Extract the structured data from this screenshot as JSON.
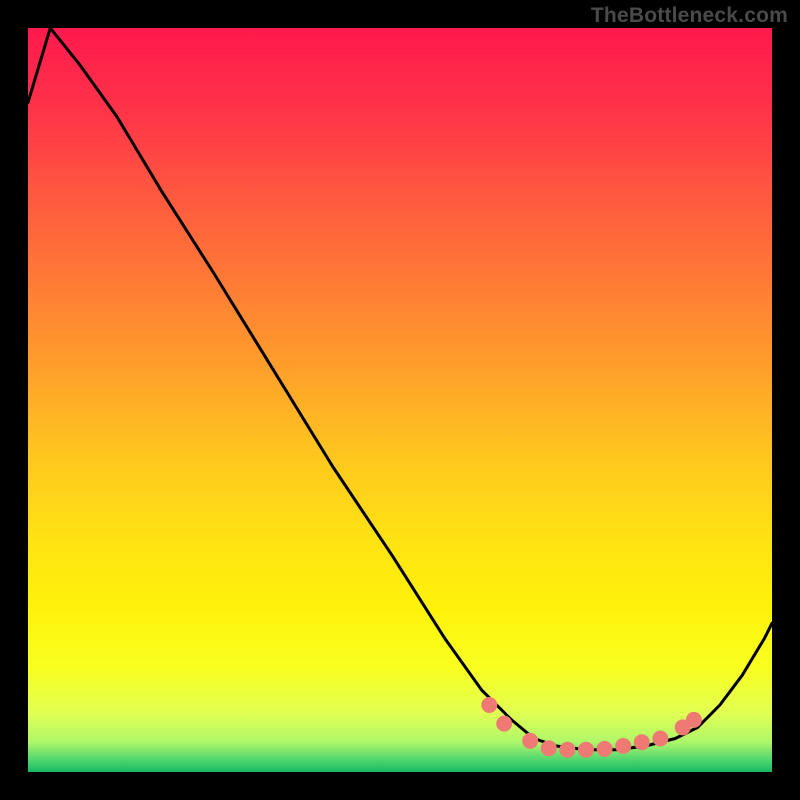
{
  "watermark": "TheBottleneck.com",
  "gradient": {
    "stops": [
      {
        "offset": 0.0,
        "color": "#ff1a4d"
      },
      {
        "offset": 0.1,
        "color": "#ff3049"
      },
      {
        "offset": 0.22,
        "color": "#ff5740"
      },
      {
        "offset": 0.34,
        "color": "#ff7a36"
      },
      {
        "offset": 0.46,
        "color": "#ffa02a"
      },
      {
        "offset": 0.58,
        "color": "#ffc81e"
      },
      {
        "offset": 0.68,
        "color": "#ffe114"
      },
      {
        "offset": 0.78,
        "color": "#fff20a"
      },
      {
        "offset": 0.86,
        "color": "#f8ff20"
      },
      {
        "offset": 0.92,
        "color": "#e2ff52"
      },
      {
        "offset": 0.96,
        "color": "#aef76a"
      },
      {
        "offset": 0.985,
        "color": "#4bd36f"
      },
      {
        "offset": 1.0,
        "color": "#18b961"
      }
    ]
  },
  "chart_data": {
    "type": "line",
    "title": "",
    "xlabel": "",
    "ylabel": "",
    "xlim": [
      0,
      1
    ],
    "ylim": [
      0,
      1
    ],
    "series": [
      {
        "name": "curve",
        "x": [
          0.0,
          0.03,
          0.07,
          0.12,
          0.18,
          0.25,
          0.33,
          0.41,
          0.49,
          0.56,
          0.61,
          0.65,
          0.68,
          0.71,
          0.75,
          0.79,
          0.83,
          0.87,
          0.9,
          0.93,
          0.96,
          0.99,
          1.0
        ],
        "values": [
          0.1,
          0.0,
          0.05,
          0.12,
          0.22,
          0.33,
          0.46,
          0.59,
          0.71,
          0.82,
          0.89,
          0.93,
          0.955,
          0.965,
          0.97,
          0.97,
          0.965,
          0.955,
          0.94,
          0.91,
          0.87,
          0.82,
          0.8
        ]
      },
      {
        "name": "dots",
        "x": [
          0.62,
          0.64,
          0.675,
          0.7,
          0.725,
          0.75,
          0.775,
          0.8,
          0.825,
          0.85,
          0.88,
          0.895
        ],
        "values": [
          0.91,
          0.935,
          0.958,
          0.968,
          0.97,
          0.97,
          0.969,
          0.965,
          0.96,
          0.955,
          0.94,
          0.93
        ]
      }
    ]
  },
  "colors": {
    "curve": "#000000",
    "dots_fill": "#ef7a73",
    "dots_stroke": "#ef7a73"
  }
}
